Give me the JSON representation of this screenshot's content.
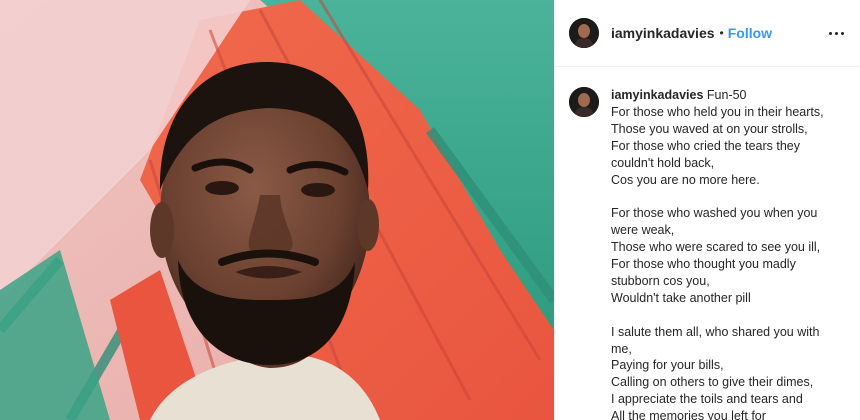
{
  "post": {
    "image_alt": "Selfie of a young man with a beard under a red and green canopy"
  },
  "header": {
    "username": "iamyinkadavies",
    "separator": "•",
    "follow_label": "Follow",
    "more_icon": "more-options-icon"
  },
  "caption": {
    "username": "iamyinkadavies",
    "title": "Fun-50",
    "lines": [
      "For those who held you in their hearts,",
      "Those you waved at on your strolls,",
      "For those who cried the tears they",
      "couldn't hold back,",
      "Cos you are no more here.",
      "",
      "For those who washed you when you",
      "were weak,",
      "Those who were scared to see you ill,",
      "For those who thought you madly",
      "stubborn cos you,",
      "Wouldn't take another pill",
      "",
      "I salute them all, who shared you with",
      "me,",
      "Paying for your bills,",
      "Calling on others to give their dimes,",
      "I appreciate the toils and tears and",
      "All the memories you left for"
    ]
  },
  "colors": {
    "link": "#3897f0",
    "text": "#262626",
    "border": "#efefef"
  }
}
